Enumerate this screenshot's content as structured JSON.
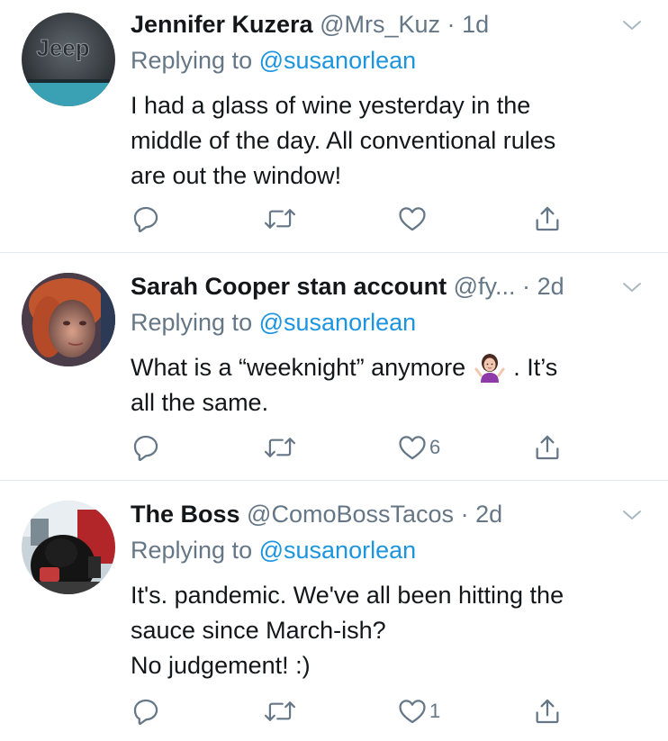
{
  "colors": {
    "text": "#14171a",
    "secondary": "#657786",
    "mention": "#1b95e0",
    "divider": "#e1e8ed"
  },
  "tweets": [
    {
      "name": "Jennifer Kuzera",
      "handle": "@Mrs_Kuz",
      "dot": "·",
      "time": "1d",
      "replying_prefix": "Replying to",
      "replying_to": "@susanorlean",
      "body_lines": [
        "I had a glass of wine yesterday in the",
        "middle of the day. All conventional rules",
        "are out the window!"
      ],
      "avatar_text": "Jeep",
      "reply_count": "",
      "retweet_count": "",
      "like_count": ""
    },
    {
      "name": "Sarah Cooper stan account",
      "handle": "@fy...",
      "dot": "·",
      "time": "2d",
      "replying_prefix": "Replying to",
      "replying_to": "@susanorlean",
      "body_before_emoji": "What is a “weeknight” anymore",
      "emoji": "person-shrugging-emoji",
      "body_after_emoji": ".  It’s",
      "body_line2": "all the same.",
      "reply_count": "",
      "retweet_count": "",
      "like_count": "6"
    },
    {
      "name": "The Boss",
      "handle": "@ComoBossTacos",
      "dot": "·",
      "time": "2d",
      "replying_prefix": "Replying to",
      "replying_to": "@susanorlean",
      "body_lines": [
        "It's. pandemic. We've all been hitting the",
        "sauce since March-ish?",
        "No judgement!  :)"
      ],
      "reply_count": "",
      "retweet_count": "",
      "like_count": "1"
    }
  ],
  "icons": {
    "reply": "reply-icon",
    "retweet": "retweet-icon",
    "like": "heart-icon",
    "share": "share-icon",
    "menu": "chevron-down-icon"
  }
}
